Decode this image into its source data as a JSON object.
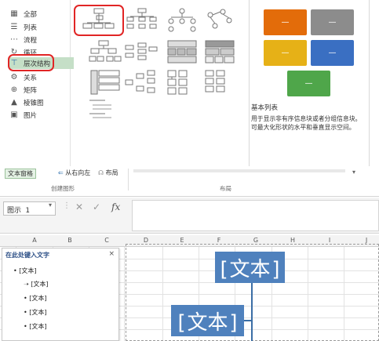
{
  "smartart_dialog": {
    "categories": [
      {
        "label": "全部",
        "icon": "all-icon"
      },
      {
        "label": "列表",
        "icon": "list-icon"
      },
      {
        "label": "流程",
        "icon": "process-icon"
      },
      {
        "label": "循环",
        "icon": "cycle-icon"
      },
      {
        "label": "层次结构",
        "icon": "hierarchy-icon",
        "selected": true
      },
      {
        "label": "关系",
        "icon": "relationship-icon"
      },
      {
        "label": "矩阵",
        "icon": "matrix-icon"
      },
      {
        "label": "棱锥图",
        "icon": "pyramid-icon"
      },
      {
        "label": "图片",
        "icon": "picture-icon"
      }
    ],
    "preview": {
      "placeholder": "—",
      "colors": [
        "#e36c0a",
        "#8c8c8c",
        "#e6b117",
        "#3a6fc2",
        "#4fa64a"
      ],
      "name": "基本列表",
      "description": "用于显示非有序信息块或者分组信息块。可最大化形状的水平和垂直显示空间。"
    }
  },
  "ribbon": {
    "buttons": [
      "文本窗格",
      "从右向左",
      "布局"
    ],
    "groups": [
      "创建图形",
      "布局"
    ]
  },
  "formula_bar": {
    "name_box": "图示 1",
    "fx": "fx"
  },
  "sheet": {
    "columns": [
      "A",
      "B",
      "C",
      "D",
      "E",
      "F",
      "G",
      "H",
      "I",
      "J"
    ]
  },
  "text_pane": {
    "title": "在此处键入文字",
    "close": "×",
    "items": [
      "[文本]",
      "[文本]",
      "[文本]",
      "[文本]",
      "[文本]"
    ]
  },
  "smartart": {
    "top_box": "[文本]",
    "left_box": "[文本]",
    "color": "#4f81bd"
  }
}
